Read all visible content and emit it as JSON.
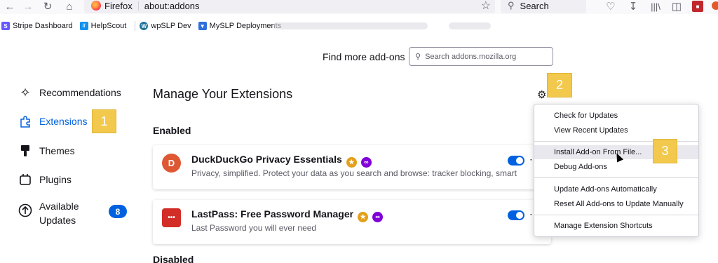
{
  "browser": {
    "brand": "Firefox",
    "url": "about:addons",
    "search_placeholder": "Search"
  },
  "bookmarks": [
    {
      "label": "Stripe Dashboard",
      "icon": "stripe-icon",
      "color": "#635bff",
      "glyph": "S"
    },
    {
      "label": "HelpScout",
      "icon": "helpscout-icon",
      "color": "#1292ee",
      "glyph": "//"
    },
    {
      "label": "wpSLP Dev",
      "icon": "wordpress-icon",
      "color": "#21759b",
      "glyph": "W"
    },
    {
      "label": "MySLP Deployments",
      "icon": "shield-icon",
      "color": "#2f6fde",
      "glyph": "▼"
    }
  ],
  "find_more": {
    "label": "Find more add-ons",
    "placeholder": "Search addons.mozilla.org"
  },
  "sidebar": {
    "items": [
      {
        "label": "Recommendations",
        "icon": "sparkle-icon"
      },
      {
        "label": "Extensions",
        "icon": "puzzle-icon",
        "active": true
      },
      {
        "label": "Themes",
        "icon": "brush-icon"
      },
      {
        "label": "Plugins",
        "icon": "plugin-icon"
      },
      {
        "label": "Available Updates",
        "icon": "update-arrow-icon",
        "badge": "8"
      }
    ],
    "accent_color": "#0061e0"
  },
  "main": {
    "heading": "Manage Your Extensions",
    "enabled_title": "Enabled",
    "disabled_title": "Disabled",
    "extensions": [
      {
        "name": "DuckDuckGo Privacy Essentials",
        "description": "Privacy, simplified. Protect your data as you search and browse: tracker blocking, smart",
        "enabled": true,
        "logo_color": "#de5833",
        "logo_glyph": "D"
      },
      {
        "name": "LastPass: Free Password Manager",
        "description": "Last Password you will ever need",
        "enabled": true,
        "logo_color": "#d32d27",
        "logo_glyph": "•••"
      }
    ]
  },
  "menu": {
    "items": [
      {
        "label": "Check for Updates"
      },
      {
        "label": "View Recent Updates"
      },
      {
        "label": "Install Add-on From File...",
        "highlighted": true
      },
      {
        "label": "Debug Add-ons"
      },
      {
        "label": "Update Add-ons Automatically"
      },
      {
        "label": "Reset All Add-ons to Update Manually"
      },
      {
        "label": "Manage Extension Shortcuts"
      }
    ]
  },
  "callouts": [
    "1",
    "2",
    "3"
  ]
}
